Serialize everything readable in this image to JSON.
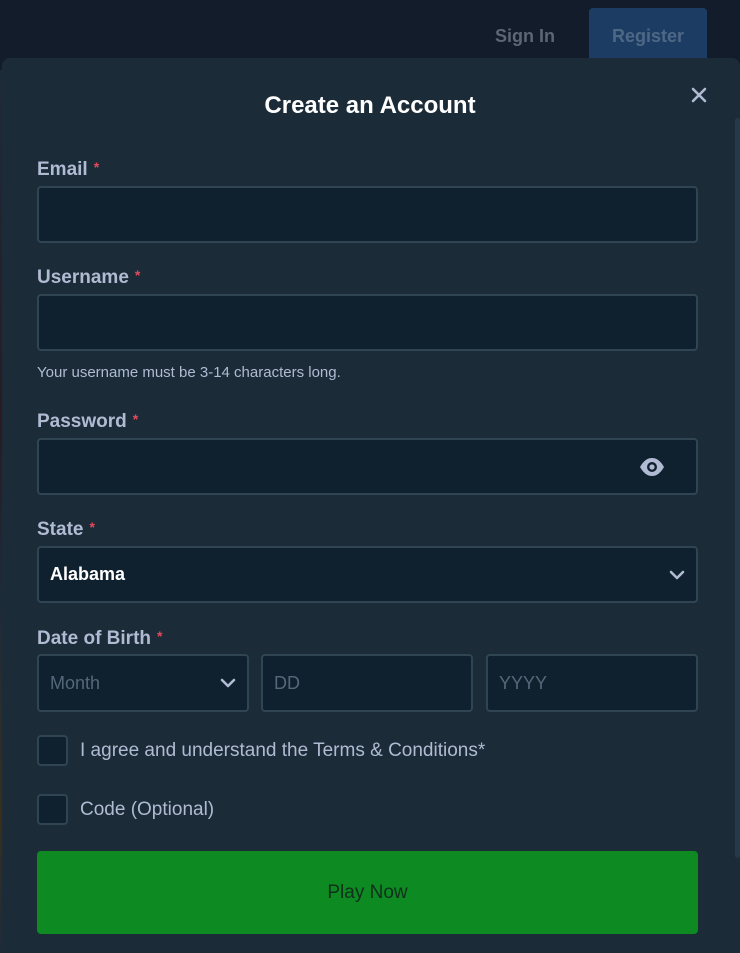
{
  "header": {
    "signin_label": "Sign In",
    "register_label": "Register"
  },
  "modal": {
    "title": "Create an Account",
    "required_marker": "*"
  },
  "form": {
    "email": {
      "label": "Email",
      "value": ""
    },
    "username": {
      "label": "Username",
      "value": "",
      "hint": "Your username must be 3-14 characters long."
    },
    "password": {
      "label": "Password",
      "value": ""
    },
    "state": {
      "label": "State",
      "value": "Alabama"
    },
    "dob": {
      "label": "Date of Birth",
      "month_placeholder": "Month",
      "day_placeholder": "DD",
      "year_placeholder": "YYYY"
    },
    "terms_label": "I agree and understand the Terms & Conditions*",
    "code_label": "Code (Optional)",
    "submit_label": "Play Now"
  },
  "colors": {
    "accent": "#0d8a22",
    "required": "#e34a5a",
    "background": "#1b2b38"
  },
  "icons": [
    "close-icon",
    "eye-icon",
    "chevron-down-icon"
  ]
}
